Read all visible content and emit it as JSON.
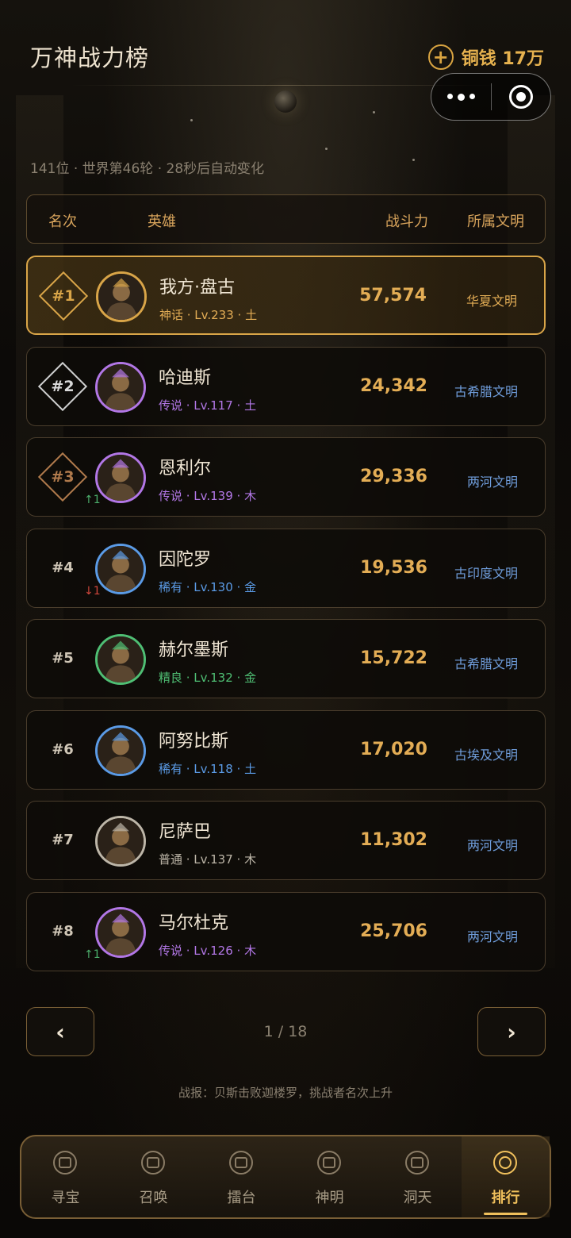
{
  "page": {
    "title": "万神战力榜",
    "subtitle": "141位 · 世界第46轮 · 28秒后自动变化"
  },
  "currency": {
    "label": "铜钱 17万",
    "add_icon": "plus-circle-icon",
    "color": "#e7b24f"
  },
  "capsule": {
    "more_icon": "more-dots-icon",
    "close_icon": "target-icon"
  },
  "table_header": {
    "rank": "名次",
    "hero": "英雄",
    "power": "战斗力",
    "civilization": "所属文明"
  },
  "rarity_colors": {
    "神话": "#e3ad55",
    "传说": "#b277e6",
    "稀有": "#5b9be6",
    "精良": "#4fbf74",
    "普通": "#bdb6a8"
  },
  "rows": [
    {
      "rank": "#1",
      "rank_style": "gold",
      "trend": "",
      "trend_dir": "",
      "name": "我方·盘古",
      "rarity": "神话",
      "meta": "神话 · Lv.233 · 土",
      "power": "57,574",
      "civilization": "华夏文明",
      "avatar_color": "#d9a548",
      "highlight": true
    },
    {
      "rank": "#2",
      "rank_style": "silver",
      "trend": "",
      "trend_dir": "",
      "name": "哈迪斯",
      "rarity": "传说",
      "meta": "传说 · Lv.117 · 土",
      "power": "24,342",
      "civilization": "古希腊文明",
      "avatar_color": "#b277e6"
    },
    {
      "rank": "#3",
      "rank_style": "bronze",
      "trend": "↑1",
      "trend_dir": "up",
      "name": "恩利尔",
      "rarity": "传说",
      "meta": "传说 · Lv.139 · 木",
      "power": "29,336",
      "civilization": "两河文明",
      "avatar_color": "#b277e6"
    },
    {
      "rank": "#4",
      "rank_style": "plain",
      "trend": "↓1",
      "trend_dir": "down",
      "name": "因陀罗",
      "rarity": "稀有",
      "meta": "稀有 · Lv.130 · 金",
      "power": "19,536",
      "civilization": "古印度文明",
      "avatar_color": "#5b9be6"
    },
    {
      "rank": "#5",
      "rank_style": "plain",
      "trend": "",
      "trend_dir": "",
      "name": "赫尔墨斯",
      "rarity": "精良",
      "meta": "精良 · Lv.132 · 金",
      "power": "15,722",
      "civilization": "古希腊文明",
      "avatar_color": "#4fbf74"
    },
    {
      "rank": "#6",
      "rank_style": "plain",
      "trend": "",
      "trend_dir": "",
      "name": "阿努比斯",
      "rarity": "稀有",
      "meta": "稀有 · Lv.118 · 土",
      "power": "17,020",
      "civilization": "古埃及文明",
      "avatar_color": "#5b9be6"
    },
    {
      "rank": "#7",
      "rank_style": "plain",
      "trend": "",
      "trend_dir": "",
      "name": "尼萨巴",
      "rarity": "普通",
      "meta": "普通 · Lv.137 · 木",
      "power": "11,302",
      "civilization": "两河文明",
      "avatar_color": "#bdb6a8"
    },
    {
      "rank": "#8",
      "rank_style": "plain",
      "trend": "↑1",
      "trend_dir": "up",
      "name": "马尔杜克",
      "rarity": "传说",
      "meta": "传说 · Lv.126 · 木",
      "power": "25,706",
      "civilization": "两河文明",
      "avatar_color": "#b277e6"
    }
  ],
  "pager": {
    "prev": "‹",
    "next": "›",
    "indicator": "1 / 18"
  },
  "battle_report": "战报：贝斯击败迦楼罗，挑战者名次上升",
  "tabs": [
    {
      "label": "寻宝",
      "icon": "treasure-icon",
      "active": false
    },
    {
      "label": "召唤",
      "icon": "summon-icon",
      "active": false
    },
    {
      "label": "擂台",
      "icon": "arena-icon",
      "active": false
    },
    {
      "label": "神明",
      "icon": "deity-icon",
      "active": false
    },
    {
      "label": "洞天",
      "icon": "cave-home-icon",
      "active": false
    },
    {
      "label": "排行",
      "icon": "ranking-icon",
      "active": true
    }
  ]
}
